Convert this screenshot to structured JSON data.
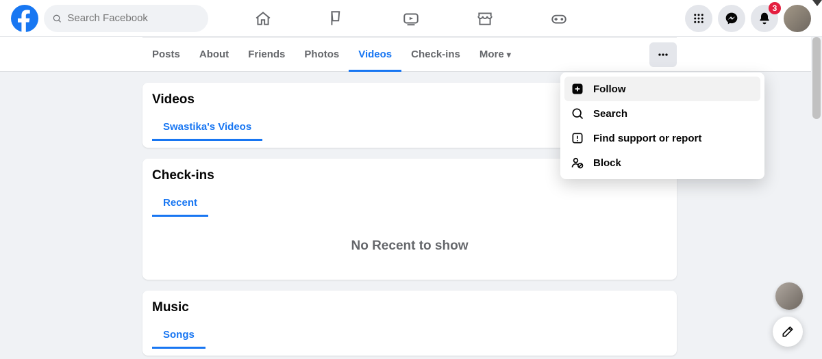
{
  "search": {
    "placeholder": "Search Facebook"
  },
  "notifications": {
    "count": "3"
  },
  "profile_tabs": {
    "items": [
      {
        "label": "Posts"
      },
      {
        "label": "About"
      },
      {
        "label": "Friends"
      },
      {
        "label": "Photos"
      },
      {
        "label": "Videos"
      },
      {
        "label": "Check-ins"
      },
      {
        "label": "More"
      }
    ],
    "active_index": 4
  },
  "sections": {
    "videos": {
      "title": "Videos",
      "subtab": "Swastika's Videos"
    },
    "checkins": {
      "title": "Check-ins",
      "subtab": "Recent",
      "empty": "No Recent to show"
    },
    "music": {
      "title": "Music",
      "subtab": "Songs"
    }
  },
  "dropdown": {
    "items": [
      {
        "label": "Follow"
      },
      {
        "label": "Search"
      },
      {
        "label": "Find support or report"
      },
      {
        "label": "Block"
      }
    ]
  },
  "colors": {
    "brand": "#1876f2",
    "icon_bg": "#e4e6eb",
    "badge": "#e41e3f"
  }
}
